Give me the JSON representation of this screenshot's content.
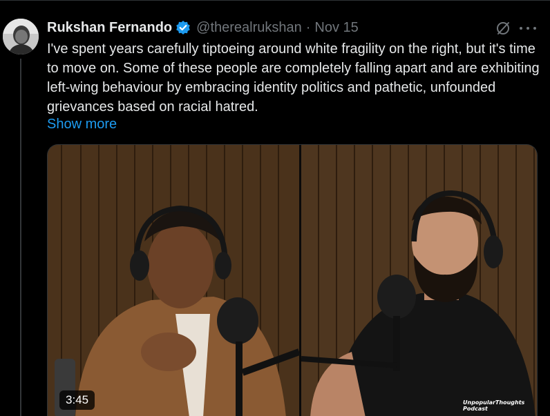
{
  "author": {
    "name": "Rukshan Fernando",
    "handle": "@therealrukshan",
    "separator": "·",
    "date": "Nov 15",
    "verified_color": "#1d9bf0"
  },
  "tweet": {
    "text": "I've spent years carefully tiptoeing around white fragility on the right, but it's time to move on. Some of these people are completely falling apart and are exhibiting left-wing behaviour by embracing identity politics and pathetic, unfounded grievances based on racial hatred.",
    "show_more_label": "Show more"
  },
  "media": {
    "duration": "3:45",
    "watermark": "UnpopularThoughts Podcast"
  },
  "icons": {
    "grok": "grok-icon",
    "more": "more-icon",
    "verified": "verified-badge-icon"
  },
  "colors": {
    "background": "#000000",
    "text": "#e7e9ea",
    "secondary": "#71767b",
    "link": "#1d9bf0"
  }
}
